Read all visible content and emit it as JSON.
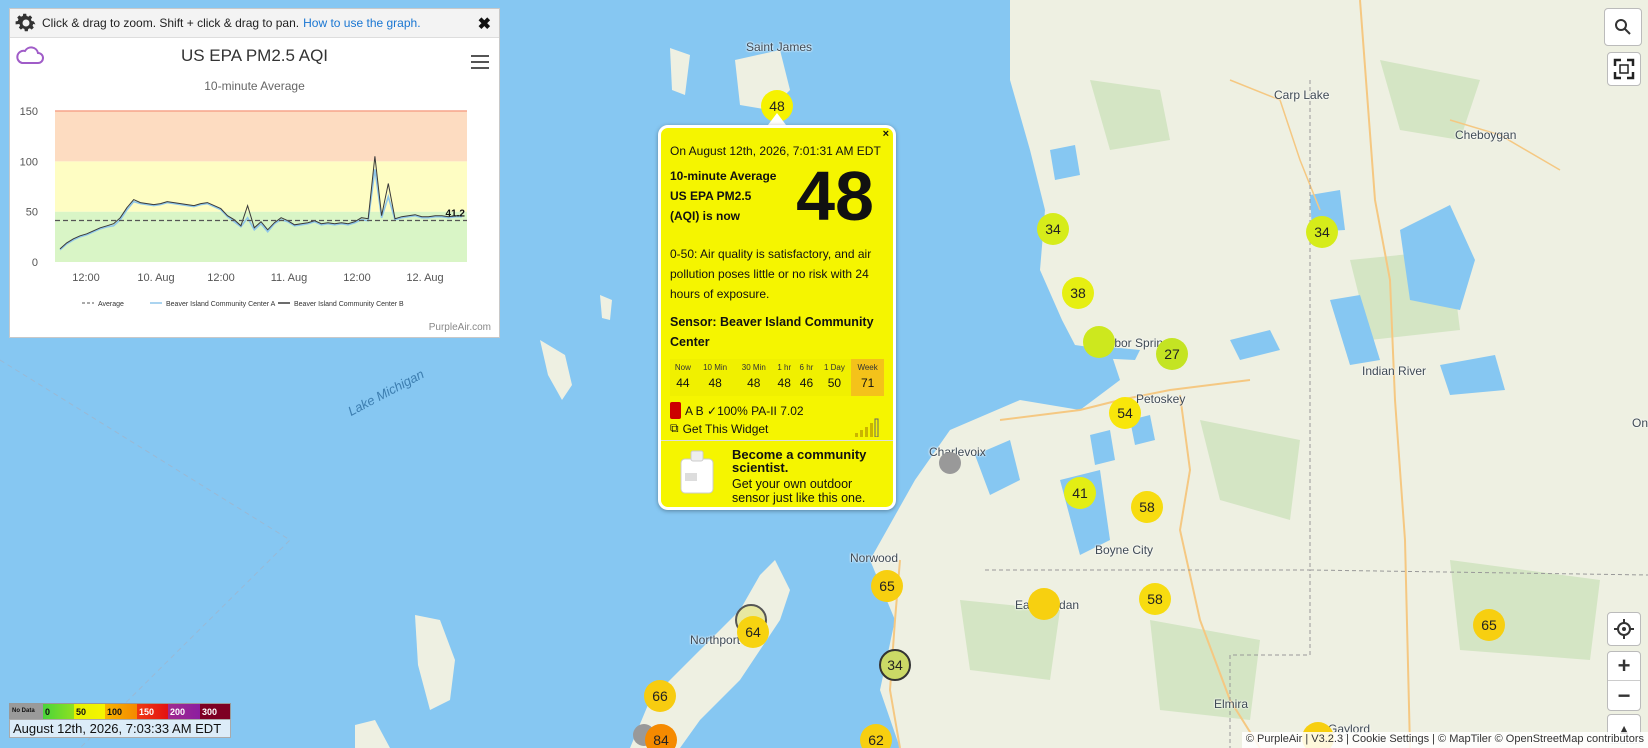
{
  "graph": {
    "hint_text": "Click & drag to zoom. Shift + click & drag to pan.",
    "hint_link": "How to use the graph.",
    "close": "✖",
    "title": "US EPA PM2.5 AQI",
    "subtitle": "10-minute Average",
    "credit": "PurpleAir.com",
    "last_value_label": "41.2",
    "legend": [
      "Average",
      "Beaver Island Community Center A",
      "Beaver Island Community Center B"
    ]
  },
  "chart_data": {
    "type": "line",
    "title": "US EPA PM2.5 AQI",
    "subtitle": "10-minute Average",
    "ylim": [
      0,
      150
    ],
    "y_ticks": [
      0,
      50,
      100,
      150
    ],
    "x_tick_labels": [
      "12:00",
      "10. Aug",
      "12:00",
      "11. Aug",
      "12:00",
      "12. Aug"
    ],
    "bands": [
      {
        "from": 0,
        "to": 50,
        "color": "#d9f5c6"
      },
      {
        "from": 50,
        "to": 100,
        "color": "#fefdc3"
      },
      {
        "from": 100,
        "to": 150,
        "color": "#fddcc1"
      }
    ],
    "average": 41.2,
    "series": [
      {
        "name": "Beaver Island Community Center A",
        "color": "#8fc6ea",
        "values": [
          12,
          18,
          22,
          25,
          27,
          30,
          33,
          35,
          36,
          42,
          52,
          60,
          58,
          57,
          56,
          57,
          59,
          58,
          57,
          56,
          55,
          57,
          58,
          55,
          52,
          45,
          40,
          35,
          44,
          32,
          38,
          30,
          38,
          42,
          40,
          36,
          37,
          38,
          40,
          37,
          38,
          37,
          38,
          37,
          39,
          42,
          41,
          92,
          44,
          65,
          42,
          44,
          45,
          46,
          44,
          44,
          45,
          45,
          44,
          45,
          45
        ]
      },
      {
        "name": "Beaver Island Community Center B",
        "color": "#3a3a3a",
        "values": [
          13,
          19,
          23,
          26,
          28,
          31,
          34,
          36,
          38,
          44,
          54,
          62,
          59,
          58,
          57,
          58,
          60,
          59,
          58,
          57,
          56,
          58,
          59,
          56,
          53,
          46,
          42,
          36,
          56,
          34,
          40,
          32,
          39,
          44,
          41,
          37,
          38,
          39,
          41,
          38,
          39,
          38,
          39,
          38,
          40,
          44,
          43,
          105,
          46,
          78,
          43,
          45,
          46,
          47,
          45,
          45,
          46,
          46,
          45,
          46,
          46
        ]
      }
    ]
  },
  "popup": {
    "close": "×",
    "date": "On August 12th, 2026, 7:01:31 AM EDT",
    "headline1": "10-minute Average",
    "headline2": "US EPA PM2.5",
    "headline3": "(AQI) is now",
    "big_value": "48",
    "description": "0-50: Air quality is satisfactory, and air pollution poses little or no risk with 24 hours of exposure.",
    "sensor": "Sensor: Beaver Island Community Center",
    "table_headers": [
      "Now",
      "10 Min",
      "30 Min",
      "1 hr",
      "6 hr",
      "1 Day",
      "Week"
    ],
    "table_values": [
      "44",
      "48",
      "48",
      "48",
      "46",
      "50",
      "71"
    ],
    "meta": "A B ✓100% PA-II 7.02",
    "widget": "Get This Widget",
    "promo_title": "Become a community scientist.",
    "promo_text": "Get your own outdoor sensor just like this one."
  },
  "map": {
    "labels": {
      "saint_james": "Saint James",
      "carp_lake": "Carp Lake",
      "cheboygan": "Cheboygan",
      "harbor_springs": "Harbor Springs",
      "petoskey": "Petoskey",
      "indian_river": "Indian River",
      "charlevoix": "Charlevoix",
      "boyne_city": "Boyne City",
      "norwood": "Norwood",
      "east_jordan": "East Jordan",
      "northport": "Northport",
      "elmira": "Elmira",
      "gaylord": "Gaylord",
      "lake_michigan": "Lake Michigan",
      "on": "On"
    },
    "markers": [
      "48",
      "34",
      "34",
      "38",
      "27",
      "54",
      "41",
      "58",
      "58",
      "65",
      "64",
      "34",
      "65",
      "66",
      "84",
      "62"
    ]
  },
  "legend": {
    "items": [
      "No Data",
      "0",
      "50",
      "100",
      "150",
      "200",
      "300"
    ],
    "colors": [
      "#9a9a9a",
      "#49d43a",
      "#f4f400",
      "#f58a00",
      "#ef1212",
      "#8c1ea0",
      "#7e0023"
    ],
    "date": "August 12th, 2026, 7:03:33 AM EDT"
  },
  "attribution": "© PurpleAir | V3.2.3 | Cookie Settings | © MapTiler © OpenStreetMap contributors"
}
